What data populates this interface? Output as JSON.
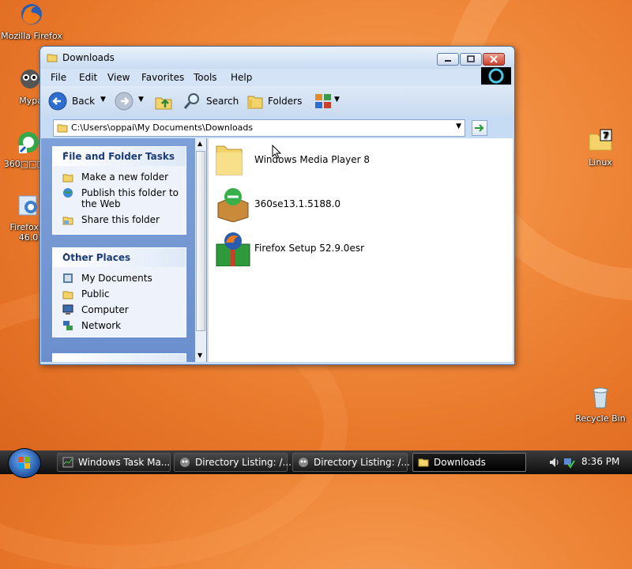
{
  "desktop": {
    "icons": [
      {
        "label": "Mozilla Firefox",
        "icon": "firefox-icon"
      },
      {
        "label": "Mypa",
        "icon": "raccoon-icon"
      },
      {
        "label": "360□□□□",
        "icon": "360-browser-icon"
      },
      {
        "label": "Firefox S",
        "label2": "46.0",
        "icon": "firefox-setup-icon"
      },
      {
        "label": "Linux",
        "icon": "linux-folder-icon"
      },
      {
        "label": "Recycle Bin",
        "icon": "recycle-bin-icon"
      }
    ]
  },
  "window": {
    "title": "Downloads",
    "menu": [
      "File",
      "Edit",
      "View",
      "Favorites",
      "Tools",
      "Help"
    ],
    "toolbar": {
      "back": "Back",
      "search": "Search",
      "folders": "Folders"
    },
    "address": "C:\\Users\\oppai\\My Documents\\Downloads",
    "tasks": {
      "title": "File and Folder Tasks",
      "items": [
        "Make a new folder",
        "Publish this folder to",
        "the Web",
        "Share this folder"
      ]
    },
    "places": {
      "title": "Other Places",
      "items": [
        "My Documents",
        "Public",
        "Computer",
        "Network"
      ]
    },
    "files": [
      {
        "name": "Windows Media Player 8",
        "icon": "folder-icon"
      },
      {
        "name": "360se13.1.5188.0",
        "icon": "360se-installer-icon"
      },
      {
        "name": "Firefox Setup 52.9.0esr",
        "icon": "firefox-installer-icon"
      }
    ]
  },
  "taskbar": {
    "buttons": [
      {
        "label": "Windows Task Ma..."
      },
      {
        "label": "Directory Listing: /..."
      },
      {
        "label": "Directory Listing: /..."
      },
      {
        "label": "Downloads"
      }
    ],
    "clock": "8:36 PM"
  },
  "colors": {
    "accent": "#1c3c78",
    "desktop": "#f08a3c"
  }
}
